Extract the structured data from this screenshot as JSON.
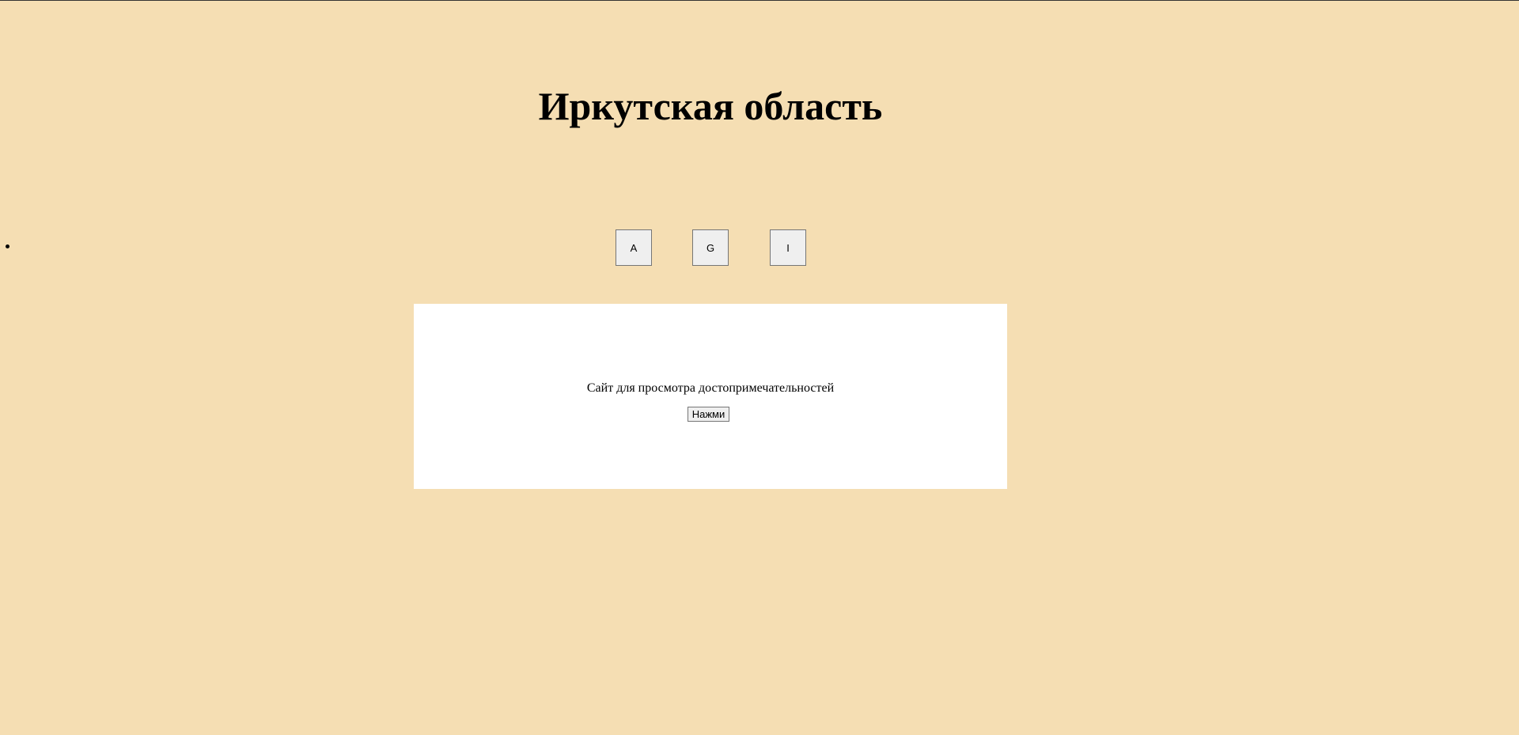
{
  "header": {
    "title": "Иркутская область"
  },
  "nav": {
    "buttons": [
      {
        "label": "A"
      },
      {
        "label": "G"
      },
      {
        "label": "I"
      }
    ]
  },
  "panel": {
    "text": "Сайт для просмотра достопримечательностей",
    "button_label": "Нажми"
  },
  "colors": {
    "background": "#f5deb3",
    "panel": "#ffffff"
  }
}
